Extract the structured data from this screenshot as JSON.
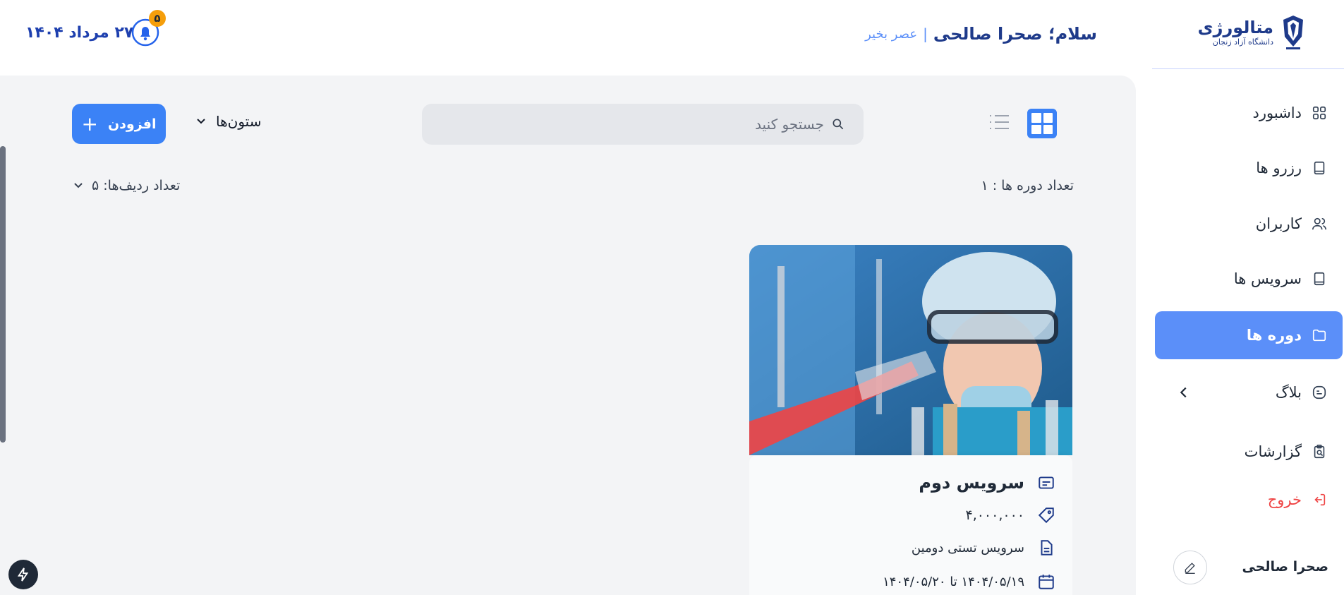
{
  "brand": {
    "title": "متالورژی",
    "subtitle": "دانشگاه آزاد زنجان"
  },
  "header": {
    "greeting": "سلام؛ صحرا صالحی",
    "separator": "|",
    "time_of_day": "عصر بخیر",
    "date": "۲۷ مرداد ۱۴۰۴",
    "notification_count": "۵"
  },
  "sidebar": {
    "items": [
      {
        "label": "داشبورد",
        "icon": "grid-icon"
      },
      {
        "label": "رزرو ها",
        "icon": "tablet-icon"
      },
      {
        "label": "کاربران",
        "icon": "users-icon"
      },
      {
        "label": "سرویس ها",
        "icon": "tablet-icon"
      },
      {
        "label": "دوره ها",
        "icon": "folder-icon",
        "active": true
      },
      {
        "label": "بلاگ",
        "icon": "blog-icon"
      },
      {
        "label": "گزارشات",
        "icon": "report-icon"
      },
      {
        "label": "خروج",
        "icon": "logout-icon"
      }
    ],
    "user_name": "صحرا صالحی"
  },
  "toolbar": {
    "search_placeholder": "جستجو کنید",
    "columns_label": "ستون‌ها",
    "add_label": "افزودن"
  },
  "summary": {
    "course_count": "تعداد دوره ها : ۱",
    "rows_count": "تعداد ردیف‌ها: ۵"
  },
  "cards": [
    {
      "title": "سرویس دوم",
      "price": "۴,۰۰۰,۰۰۰",
      "description": "سرویس تستی دومین",
      "dates": "۱۴۰۴/۰۵/۱۹ تا ۱۴۰۴/۰۵/۲۰"
    }
  ],
  "colors": {
    "primary": "#3b82f6",
    "active_nav": "#5b8ff9",
    "brand_text": "#1e3a8a",
    "logout": "#ef4444",
    "badge": "#f59e0b"
  }
}
